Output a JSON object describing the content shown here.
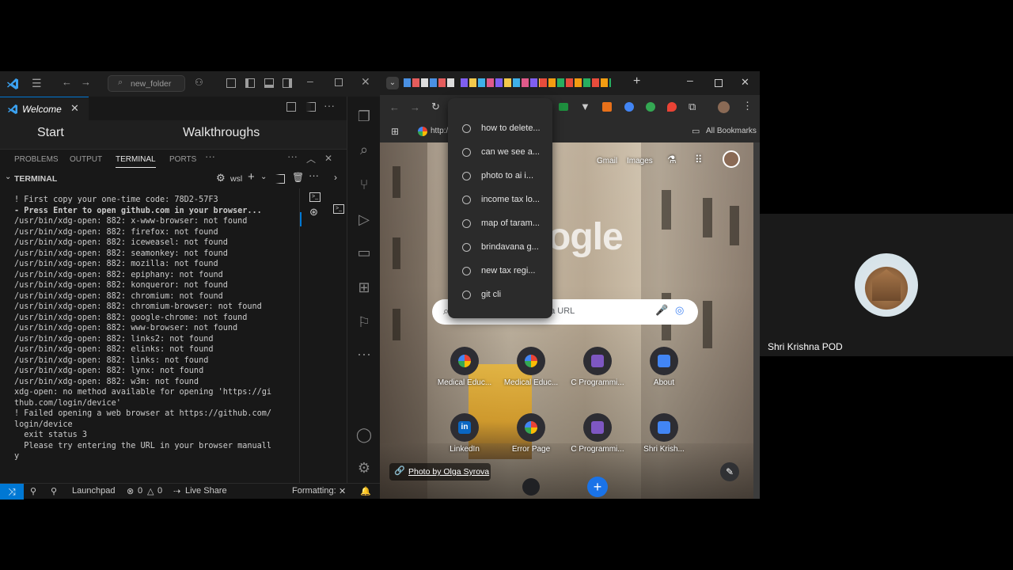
{
  "vscode": {
    "title_search": "new_folder",
    "tab_welcome": "Welcome",
    "editor_start": "Start",
    "editor_walkthroughs": "Walkthroughs",
    "panel_tabs": [
      "PROBLEMS",
      "OUTPUT",
      "TERMINAL",
      "PORTS"
    ],
    "terminal_header": "TERMINAL",
    "terminal_shell": "wsl",
    "terminal_lines": [
      "",
      "! First copy your one-time code: 78D2-57F3",
      "- Press Enter to open github.com in your browser...",
      "/usr/bin/xdg-open: 882: x-www-browser: not found",
      "/usr/bin/xdg-open: 882: firefox: not found",
      "/usr/bin/xdg-open: 882: iceweasel: not found",
      "/usr/bin/xdg-open: 882: seamonkey: not found",
      "/usr/bin/xdg-open: 882: mozilla: not found",
      "/usr/bin/xdg-open: 882: epiphany: not found",
      "/usr/bin/xdg-open: 882: konqueror: not found",
      "/usr/bin/xdg-open: 882: chromium: not found",
      "/usr/bin/xdg-open: 882: chromium-browser: not found",
      "/usr/bin/xdg-open: 882: google-chrome: not found",
      "/usr/bin/xdg-open: 882: www-browser: not found",
      "/usr/bin/xdg-open: 882: links2: not found",
      "/usr/bin/xdg-open: 882: elinks: not found",
      "/usr/bin/xdg-open: 882: links: not found",
      "/usr/bin/xdg-open: 882: lynx: not found",
      "/usr/bin/xdg-open: 882: w3m: not found",
      "xdg-open: no method available for opening 'https://gi",
      "thub.com/login/device'",
      "! Failed opening a web browser at https://github.com/",
      "login/device",
      "  exit status 3",
      "  Please try entering the URL in your browser manuall",
      "y"
    ],
    "status": {
      "launchpad": "Launchpad",
      "problems": "0",
      "warnings": "0",
      "live_share": "Live Share",
      "formatting": "Formatting:"
    }
  },
  "chrome": {
    "address_text": "G",
    "bookmark_url": "http:/",
    "all_bookmarks": "All Bookmarks",
    "gmail": "Gmail",
    "images": "Images",
    "search_placeholder": "Search Google or type a URL",
    "logo_partial": "ogle",
    "photo_credit": "Photo by Olga Syrova",
    "dropdown": [
      "how to delete...",
      "can we see a...",
      "photo to ai i...",
      "income tax lo...",
      "map of taram...",
      "brindavana g...",
      "new tax regi...",
      "git cli"
    ],
    "shortcuts_row1": [
      "Medical Educ...",
      "Medical Educ...",
      "C Programmi...",
      "About"
    ],
    "shortcuts_row2": [
      "LinkedIn",
      "Error Page",
      "C Programmi...",
      "Shri Krish..."
    ]
  },
  "meet": {
    "participant_name": "Shri Krishna POD"
  },
  "colors": {
    "vscode_accent": "#0078d4",
    "chrome_bg": "#202124"
  }
}
